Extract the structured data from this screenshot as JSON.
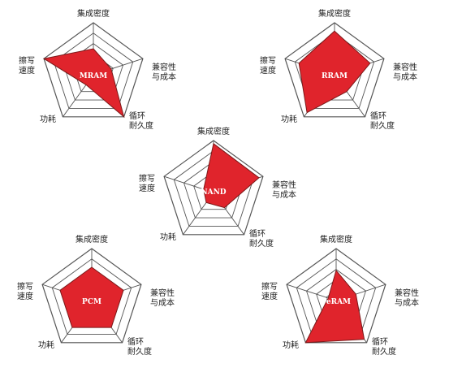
{
  "colors": {
    "fill": "#e0242c",
    "stroke": "#7a1a1a",
    "grid": "#555555",
    "title_text": "#ffffff"
  },
  "axes": [
    "集成密度",
    "兼容性\n与成本",
    "循环\n耐久度",
    "功耗",
    "擦写\n速度"
  ],
  "levels": 5,
  "chart_data": [
    {
      "type": "radar",
      "title": "MRAM",
      "values": [
        2.5,
        1.8,
        5.0,
        1.2,
        5.0
      ]
    },
    {
      "type": "radar",
      "title": "RRAM",
      "values": [
        4.2,
        3.6,
        2.0,
        4.5,
        3.6
      ]
    },
    {
      "type": "radar",
      "title": "NAND",
      "values": [
        4.7,
        4.6,
        1.8,
        1.2,
        1.0
      ]
    },
    {
      "type": "radar",
      "title": "PCM",
      "values": [
        3.2,
        3.2,
        3.2,
        3.2,
        3.2
      ]
    },
    {
      "type": "radar",
      "title": "FeRAM",
      "values": [
        2.9,
        2.0,
        4.6,
        5.0,
        0.8
      ]
    }
  ]
}
